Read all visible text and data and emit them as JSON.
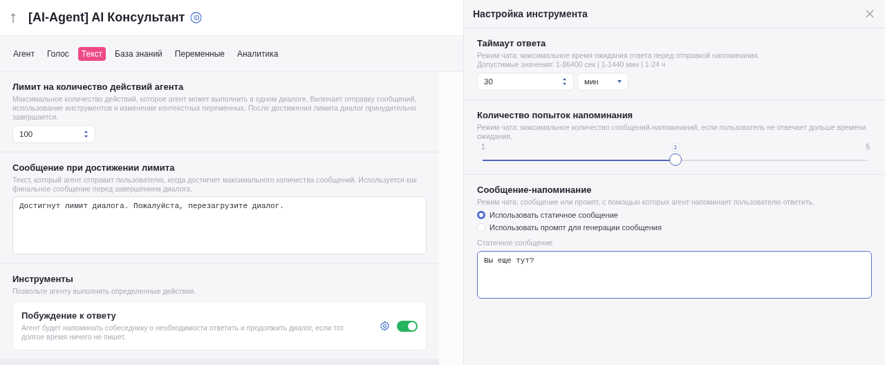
{
  "header": {
    "title": "[AI-Agent] AI Консультант"
  },
  "tabs": [
    {
      "label": "Агент",
      "selected": false
    },
    {
      "label": "Голос",
      "selected": false
    },
    {
      "label": "Текст",
      "selected": true
    },
    {
      "label": "База знаний",
      "selected": false
    },
    {
      "label": "Переменные",
      "selected": false
    },
    {
      "label": "Аналитика",
      "selected": false
    }
  ],
  "sections": [
    {
      "kind": "number",
      "title": "Лимит на количество действий агента",
      "description": "Максимальное количество действий, которое агент может выполнить в одном диалоге. Включает отправку сообщений, использование инструментов и изменение контекстных переменных. После достижения лимита диалог принудительно завершается.",
      "value": "100"
    },
    {
      "kind": "textarea",
      "title": "Сообщение при достижении лимита",
      "description": "Текст, который агент отправит пользователю, когда достигнет максимального количества сообщений. Используется как финальное сообщение перед завершением диалога.",
      "value": "Достигнут лимит диалога. Пожалуйста, перезагрузите диалог."
    },
    {
      "kind": "tools",
      "title": "Инструменты",
      "description": "Позвольте агенту выполнить определенные действия.",
      "tools": [
        {
          "name": "Побуждение к ответу",
          "description": "Агент будет напоминать собеседнику о необходимости ответить и продолжить диалог, если тот долгое время ничего не пишет.",
          "on": true
        }
      ]
    }
  ],
  "panel": {
    "title": "Настройка инструмента",
    "timeout": {
      "title": "Таймаут ответа",
      "description": [
        "Режим чата: максимальное время ожидания ответа перед отправкой напоминания.",
        "Допустимые значения: 1-86400 сек | 1-1440 мин | 1-24 ч"
      ],
      "value": "30",
      "unit": "мин"
    },
    "attempts": {
      "title": "Количество попыток напоминания",
      "description": "Режим чата: максимальное количество сообщений-напоминаний, если пользователь не отвечает дольше времени ожидания.",
      "min_label": "1",
      "value_label": "3",
      "max_label": "5",
      "level": 0.5
    },
    "reminder": {
      "title": "Сообщение-напоминание",
      "description": "Режим чата: сообщение или промпт, с помощью которых агент напоминает пользователю ответить.",
      "options": [
        {
          "label": "Использовать статичное сообщение",
          "selected": true
        },
        {
          "label": "Использовать промпт для генерации сообщения",
          "selected": false
        }
      ],
      "field_label": "Статичное сообщение",
      "value": "Вы еще тут?"
    }
  }
}
